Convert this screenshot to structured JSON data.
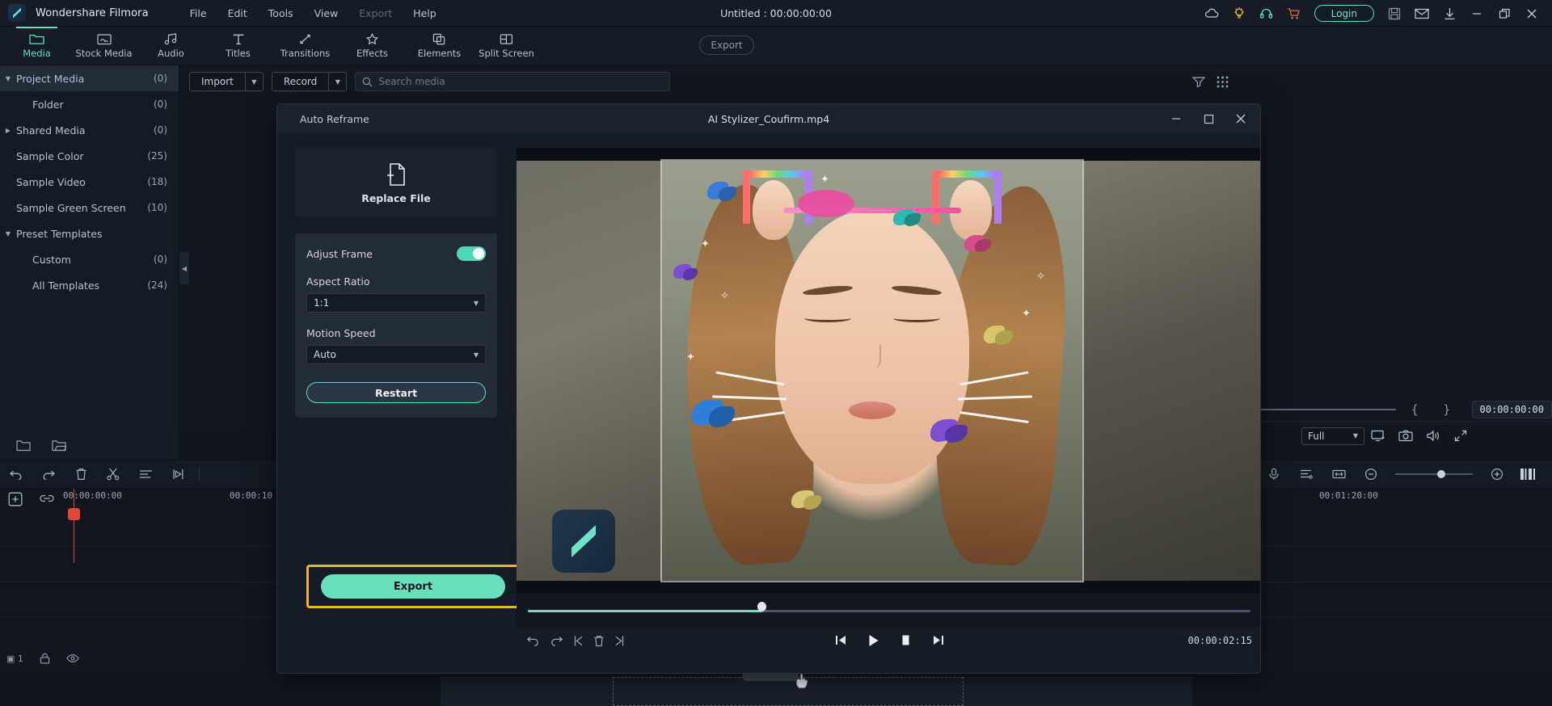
{
  "app": {
    "name": "Wondershare Filmora",
    "project_title": "Untitled : 00:00:00:00",
    "login_label": "Login"
  },
  "menus": [
    {
      "label": "File",
      "disabled": false
    },
    {
      "label": "Edit",
      "disabled": false
    },
    {
      "label": "Tools",
      "disabled": false
    },
    {
      "label": "View",
      "disabled": false
    },
    {
      "label": "Export",
      "disabled": true
    },
    {
      "label": "Help",
      "disabled": false
    }
  ],
  "top_right_icons": [
    {
      "name": "cloud-icon"
    },
    {
      "name": "lightbulb-icon"
    },
    {
      "name": "headset-icon"
    },
    {
      "name": "cart-icon"
    },
    {
      "name": "save-icon"
    },
    {
      "name": "mail-icon"
    },
    {
      "name": "download-icon"
    },
    {
      "name": "minimize-icon"
    },
    {
      "name": "restore-icon"
    },
    {
      "name": "close-icon"
    }
  ],
  "ribbon": {
    "tabs": [
      {
        "label": "Media",
        "icon": "folder-icon",
        "active": true
      },
      {
        "label": "Stock Media",
        "icon": "stock-media-icon",
        "active": false
      },
      {
        "label": "Audio",
        "icon": "music-note-icon",
        "active": false
      },
      {
        "label": "Titles",
        "icon": "text-t-icon",
        "active": false
      },
      {
        "label": "Transitions",
        "icon": "transitions-icon",
        "active": false
      },
      {
        "label": "Effects",
        "icon": "effects-star-icon",
        "active": false
      },
      {
        "label": "Elements",
        "icon": "elements-icon",
        "active": false
      },
      {
        "label": "Split Screen",
        "icon": "split-screen-icon",
        "active": false
      }
    ],
    "export_label": "Export"
  },
  "sidebar": {
    "items": [
      {
        "label": "Project Media",
        "count": "(0)",
        "level": 0,
        "caret": "down",
        "selected": true
      },
      {
        "label": "Folder",
        "count": "(0)",
        "level": 1,
        "caret": "none",
        "selected": false
      },
      {
        "label": "Shared Media",
        "count": "(0)",
        "level": 0,
        "caret": "right",
        "selected": false
      },
      {
        "label": "Sample Color",
        "count": "(25)",
        "level": 0,
        "caret": "none",
        "selected": false
      },
      {
        "label": "Sample Video",
        "count": "(18)",
        "level": 0,
        "caret": "none",
        "selected": false
      },
      {
        "label": "Sample Green Screen",
        "count": "(10)",
        "level": 0,
        "caret": "none",
        "selected": false
      },
      {
        "label": "Preset Templates",
        "count": "",
        "level": 0,
        "caret": "down",
        "selected": false
      },
      {
        "label": "Custom",
        "count": "(0)",
        "level": 1,
        "caret": "none",
        "selected": false
      },
      {
        "label": "All Templates",
        "count": "(24)",
        "level": 1,
        "caret": "none",
        "selected": false
      }
    ],
    "bottom_icons": [
      {
        "name": "new-folder-icon"
      },
      {
        "name": "open-folder-icon"
      }
    ]
  },
  "media_toolbar": {
    "import_label": "Import",
    "record_label": "Record",
    "search_placeholder": "Search media",
    "search_value": "",
    "filter_icon": "filter-icon",
    "grid_icon": "grid-view-icon"
  },
  "right_panel": {
    "timecode": "00:00:00:00",
    "quality_label": "Full",
    "mark_in": "{",
    "mark_out": "}"
  },
  "timeline": {
    "ruler_labels": [
      "00:00:00:00",
      "00:00:10",
      "00:01:20:00"
    ],
    "zoom_level": 55
  },
  "dialog": {
    "title_left": "Auto Reframe",
    "title_center": "AI Stylizer_Coufirm.mp4",
    "window_buttons": [
      {
        "name": "dialog-minimize-icon",
        "glyph": "—"
      },
      {
        "name": "dialog-maximize-icon",
        "glyph": "☐"
      },
      {
        "name": "dialog-close-icon",
        "glyph": "✕"
      }
    ],
    "replace_file_label": "Replace File",
    "adjust_frame_label": "Adjust Frame",
    "adjust_frame_on": true,
    "aspect_ratio_label": "Aspect Ratio",
    "aspect_ratio_value": "1:1",
    "motion_speed_label": "Motion Speed",
    "motion_speed_value": "Auto",
    "restart_label": "Restart",
    "export_label": "Export",
    "export_highlight_color": "#f5b317",
    "accent_color": "#68e0bd",
    "player": {
      "current_time": "00:00:02:15",
      "progress_percent": 32,
      "controls": [
        {
          "name": "undo-icon"
        },
        {
          "name": "redo-icon"
        },
        {
          "name": "mark-in-icon"
        },
        {
          "name": "delete-icon"
        },
        {
          "name": "mark-out-icon"
        }
      ],
      "transport": [
        {
          "name": "step-back-icon"
        },
        {
          "name": "play-icon"
        },
        {
          "name": "stop-icon"
        },
        {
          "name": "step-forward-icon"
        }
      ]
    }
  }
}
